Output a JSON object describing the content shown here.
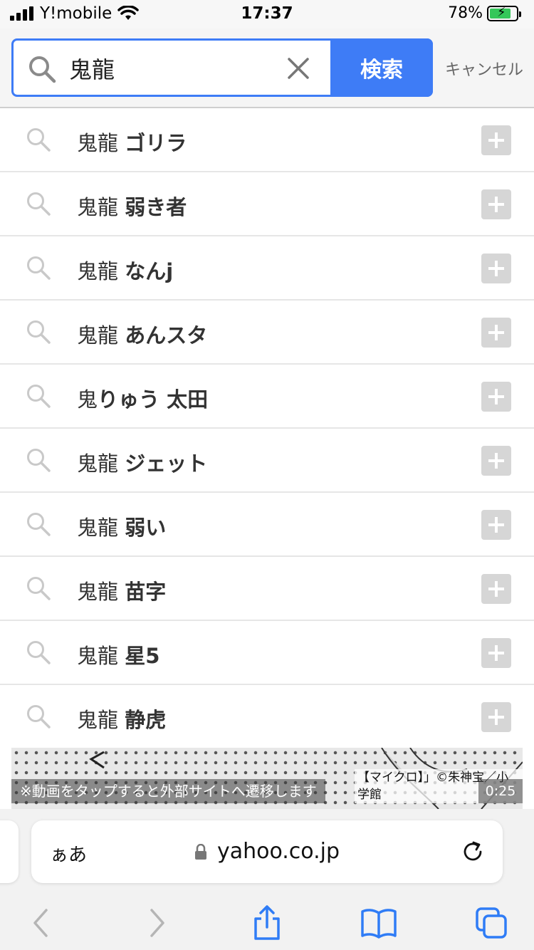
{
  "status_bar": {
    "carrier": "Y!mobile",
    "time": "17:37",
    "battery": "78%"
  },
  "search": {
    "query": "鬼龍",
    "button_label": "検索",
    "cancel_label": "キャンセル"
  },
  "suggestions": [
    {
      "prefix": "鬼龍",
      "suffix": "ゴリラ"
    },
    {
      "prefix": "鬼龍",
      "suffix": "弱き者"
    },
    {
      "prefix": "鬼龍",
      "suffix": "なんj"
    },
    {
      "prefix": "鬼龍",
      "suffix": "あんスタ"
    },
    {
      "prefix": "鬼",
      "suffix": "りゅう 太田"
    },
    {
      "prefix": "鬼龍",
      "suffix": "ジェット"
    },
    {
      "prefix": "鬼龍",
      "suffix": "弱い"
    },
    {
      "prefix": "鬼龍",
      "suffix": "苗字"
    },
    {
      "prefix": "鬼龍",
      "suffix": "星5"
    },
    {
      "prefix": "鬼龍",
      "suffix": "静虎"
    }
  ],
  "video": {
    "notice": "※動画をタップすると外部サイトへ遷移します",
    "credit": "【マイクロ】」©朱神宝／小学館",
    "duration": "0:25"
  },
  "browser": {
    "aa_label": "ぁあ",
    "url": "yahoo.co.jp"
  },
  "colors": {
    "accent": "#3e7cf6",
    "toolbar_icon": "#2f7cf6",
    "disabled_icon": "#b5b5b5"
  }
}
